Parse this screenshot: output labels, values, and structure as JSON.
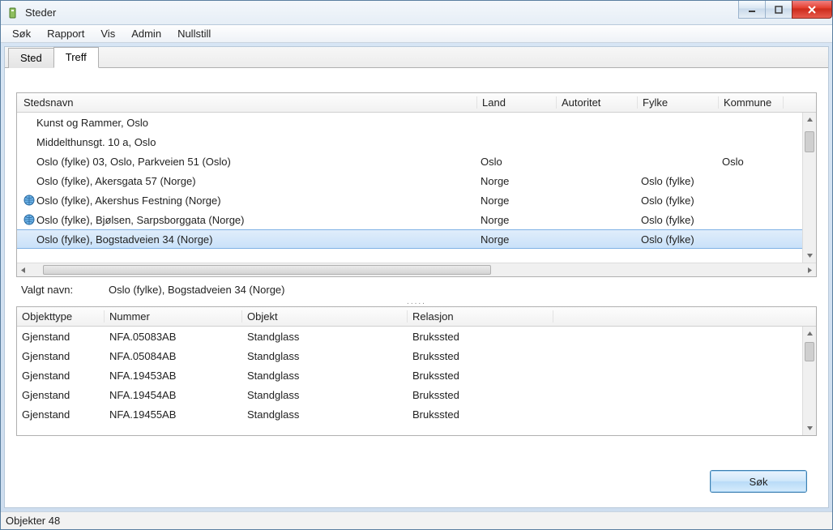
{
  "window": {
    "title": "Steder"
  },
  "menu": {
    "items": [
      "Søk",
      "Rapport",
      "Vis",
      "Admin",
      "Nullstill"
    ]
  },
  "tabs": {
    "sted": "Sted",
    "treff": "Treff",
    "active": "treff"
  },
  "upperGrid": {
    "headers": {
      "stedsnavn": "Stedsnavn",
      "land": "Land",
      "autoritet": "Autoritet",
      "fylke": "Fylke",
      "kommune": "Kommune"
    },
    "rows": [
      {
        "icon": false,
        "stedsnavn": "Kunst og Rammer, Oslo",
        "land": "",
        "autoritet": "",
        "fylke": "",
        "kommune": ""
      },
      {
        "icon": false,
        "stedsnavn": "Middelthunsgt. 10 a, Oslo",
        "land": "",
        "autoritet": "",
        "fylke": "",
        "kommune": ""
      },
      {
        "icon": false,
        "stedsnavn": "Oslo (fylke)  03, Oslo, Parkveien 51 (Oslo)",
        "land": "Oslo",
        "autoritet": "",
        "fylke": "",
        "kommune": "Oslo"
      },
      {
        "icon": false,
        "stedsnavn": "Oslo (fylke), Akersgata 57 (Norge)",
        "land": "Norge",
        "autoritet": "",
        "fylke": "Oslo (fylke)",
        "kommune": ""
      },
      {
        "icon": true,
        "stedsnavn": "Oslo (fylke), Akershus Festning (Norge)",
        "land": "Norge",
        "autoritet": "",
        "fylke": "Oslo (fylke)",
        "kommune": ""
      },
      {
        "icon": true,
        "stedsnavn": "Oslo (fylke), Bjølsen, Sarpsborggata (Norge)",
        "land": "Norge",
        "autoritet": "",
        "fylke": "Oslo (fylke)",
        "kommune": ""
      },
      {
        "icon": false,
        "stedsnavn": "Oslo (fylke), Bogstadveien 34 (Norge)",
        "land": "Norge",
        "autoritet": "",
        "fylke": "Oslo (fylke)",
        "kommune": "",
        "selected": true
      }
    ]
  },
  "selected": {
    "label": "Valgt navn:",
    "value": "Oslo (fylke), Bogstadveien 34 (Norge)"
  },
  "lowerGrid": {
    "headers": {
      "objekttype": "Objekttype",
      "nummer": "Nummer",
      "objekt": "Objekt",
      "relasjon": "Relasjon"
    },
    "rows": [
      {
        "objekttype": "Gjenstand",
        "nummer": "NFA.05083AB",
        "objekt": "Standglass",
        "relasjon": "Brukssted"
      },
      {
        "objekttype": "Gjenstand",
        "nummer": "NFA.05084AB",
        "objekt": "Standglass",
        "relasjon": "Brukssted"
      },
      {
        "objekttype": "Gjenstand",
        "nummer": "NFA.19453AB",
        "objekt": "Standglass",
        "relasjon": "Brukssted"
      },
      {
        "objekttype": "Gjenstand",
        "nummer": "NFA.19454AB",
        "objekt": "Standglass",
        "relasjon": "Brukssted"
      },
      {
        "objekttype": "Gjenstand",
        "nummer": "NFA.19455AB",
        "objekt": "Standglass",
        "relasjon": "Brukssted"
      }
    ]
  },
  "buttons": {
    "search": "Søk"
  },
  "status": {
    "text": "Objekter 48"
  }
}
